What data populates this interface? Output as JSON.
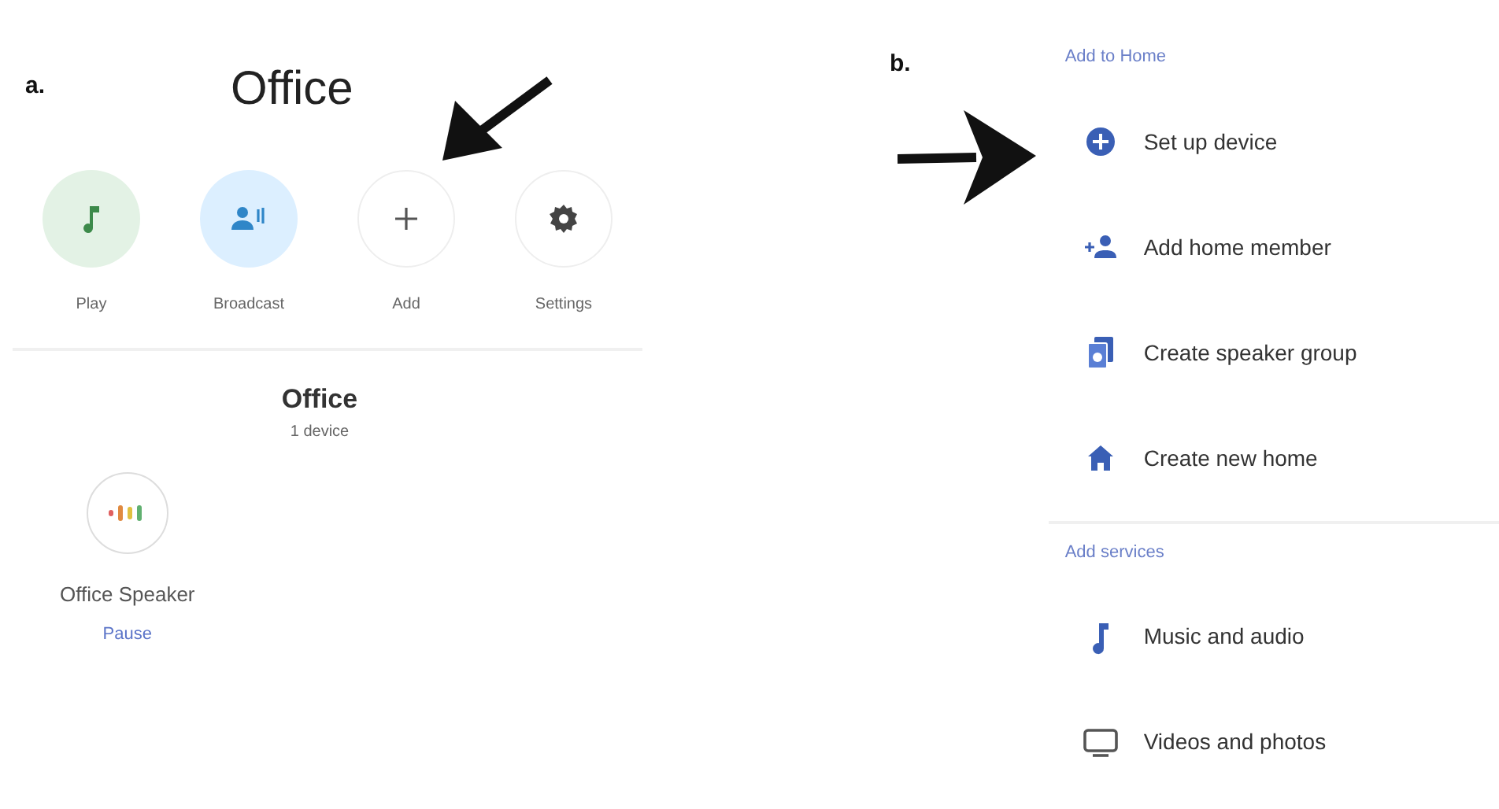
{
  "panel_a": {
    "label": "a.",
    "title": "Office",
    "actions": [
      {
        "kind": "play",
        "label": "Play"
      },
      {
        "kind": "broadcast",
        "label": "Broadcast"
      },
      {
        "kind": "add",
        "label": "Add"
      },
      {
        "kind": "settings",
        "label": "Settings"
      }
    ],
    "room": {
      "name": "Office",
      "count": "1 device"
    },
    "devices": [
      {
        "name": "Office Speaker",
        "action": "Pause"
      }
    ]
  },
  "panel_b": {
    "label": "b.",
    "sections": [
      {
        "heading": "Add to Home",
        "items": [
          {
            "kind": "setup",
            "label": "Set up device"
          },
          {
            "kind": "member",
            "label": "Add home member"
          },
          {
            "kind": "group",
            "label": "Create speaker group"
          },
          {
            "kind": "home",
            "label": "Create new home"
          }
        ]
      },
      {
        "heading": "Add services",
        "items": [
          {
            "kind": "music",
            "label": "Music and audio"
          },
          {
            "kind": "video",
            "label": "Videos and photos"
          }
        ]
      }
    ]
  }
}
